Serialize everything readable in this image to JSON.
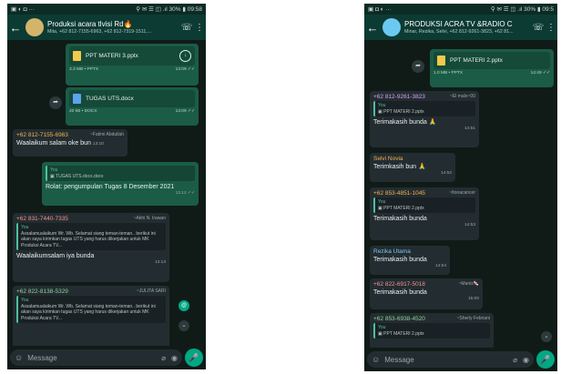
{
  "left": {
    "status": {
      "left": "▣ ◐ ◘ ···",
      "right": "⚲ ✉ ☰ ◫ .ıl 30% ▮ 09:58"
    },
    "header": {
      "title": "Produksi acara tlvisi Rd🔥",
      "subtitle": "Mita, +62 812-7155-6963, +62 812-7319-1511,..."
    },
    "doc1": {
      "name": "PPT MATERI 3.pptx",
      "size": "3.3 MB • PPTX",
      "time": "13:09 ✓✓"
    },
    "doc2": {
      "name": "TUGAS UTS.docx",
      "size": "20 kB • DOCX",
      "time": "13:09 ✓✓"
    },
    "m1": {
      "number": "+62 812-7155-6963",
      "name": "~Fatimi Abdullah",
      "text": "Waalaikum salam oke bun",
      "time": "13:10"
    },
    "m2": {
      "you": "You",
      "quote": "▣ TUGAS UTS.docx.docx",
      "text": "Rolat: pengumpulan Tugas 8 Desember 2021",
      "time": "13:12 ✓✓"
    },
    "m3": {
      "number": "+62 831-7440-7335",
      "name": "~Akhi N. Irawan",
      "you": "You",
      "quote": "Assalamualaikum Wr. Wb. Selamat siang teman-teman.. berikut ini akan saya kirimkan tugas UTS yang harus dikerjakan untuk MK Produksi Acara TV...",
      "text": "Waalaikumsalam iya bunda",
      "time": "13:13"
    },
    "m4": {
      "number": "+62 822-8138-5329",
      "name": "~JULITA SARI",
      "you": "You",
      "quote": "Assalamualaikum Wr. Wb. Selamat siang teman-teman.. berikut ini akan saya kirimkan tugas UTS yang harus dikerjakan untuk MK Produksi Acara TV..."
    },
    "badge": "@",
    "input_placeholder": "Message"
  },
  "right": {
    "status": {
      "left": "▣ ◘ ◐ ···",
      "right": "⚲ ✉ ☰ ◫ .ıl 30% ▮ 09:5"
    },
    "header": {
      "title": "PRODUKSI ACRA TV &RADIO C",
      "subtitle": "Minar, Rezika, Selvi, +62 812-9261-3823, +62 81..."
    },
    "doc1": {
      "name": "PPT MATERI 2.pptx",
      "size": "1.0 MB • PPTX",
      "time": "14:49 ✓✓"
    },
    "m1": {
      "number": "+62 812-9261-3823",
      "name": "~El malo~00",
      "you": "You",
      "quote": "▣ PPT MATERI 2.pptx",
      "text": "Terimakasih bunda 🙏",
      "time": "14:51"
    },
    "m2": {
      "name": "Selvi Novia",
      "text": "Terimkasih bun 🙏",
      "time": "14:52"
    },
    "m3": {
      "number": "+62 853-4851-1045",
      "name": "~fionacancer",
      "you": "You",
      "quote": "▣ PPT MATERI 2.pptx",
      "text": "Terimakasih bunda",
      "time": "14:53"
    },
    "m4": {
      "name": "Rezika Utama",
      "text": "Terimakasih bunda",
      "time": "14:54"
    },
    "m5": {
      "number": "+62 822-6917-5018",
      "name": "~Manis🍬",
      "text": "Terimakasih bunda",
      "time": "15:00"
    },
    "m6": {
      "number": "+62 853-6938-4520",
      "name": "~Sherly Febriani",
      "you": "You",
      "quote": "▣ PPT MATERI 2.pptx"
    },
    "input_placeholder": "Message"
  }
}
